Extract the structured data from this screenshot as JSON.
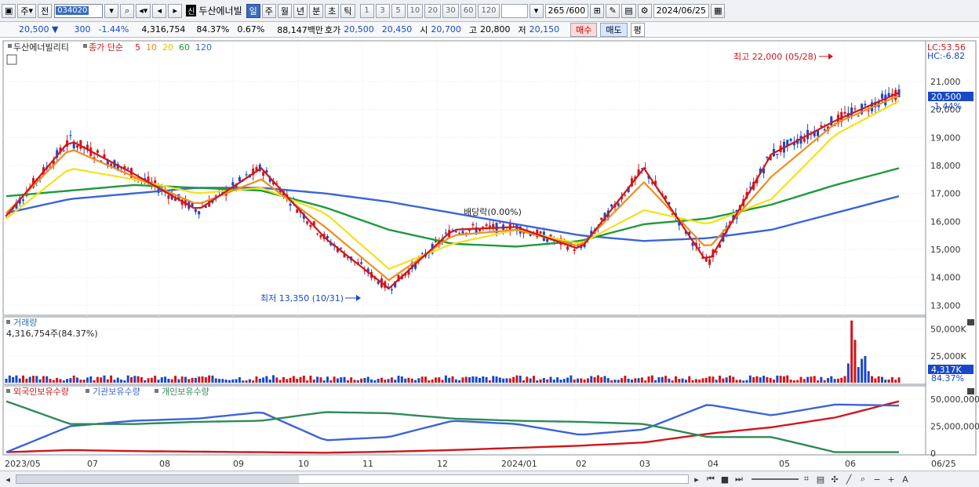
{
  "toolbar": {
    "market_select": "주",
    "prev_label": "전",
    "code": "034020",
    "stock_name": "두산에너빌",
    "credit_badge": "신",
    "periods": [
      "일",
      "주",
      "월",
      "년",
      "분",
      "초",
      "틱"
    ],
    "selected_period": "일",
    "intervals": [
      "1",
      "3",
      "5",
      "10",
      "20",
      "30",
      "60",
      "120"
    ],
    "count": "265",
    "count_max": "/600",
    "date": "2024/06/25"
  },
  "quote": {
    "price": "20,500",
    "direction": "▼",
    "change": "300",
    "change_pct": "-1.44%",
    "volume": "4,316,754",
    "vol_ratio": "84.37%",
    "turnover": "0.67%",
    "amount": "88,147백만",
    "bid_label": "호가",
    "ask": "20,500",
    "bid": "20,450",
    "open_label": "시",
    "open": "20,700",
    "high_label": "고",
    "high": "20,800",
    "low_label": "저",
    "low": "20,150",
    "buy_label": "매수",
    "sell_label": "매도",
    "avg_label": "평"
  },
  "price_panel": {
    "legend_name": "두산에너빌리티",
    "legend_ma": "종가 단순",
    "ma_periods": [
      "5",
      "10",
      "20",
      "60",
      "120"
    ],
    "lc": "LC:53.56",
    "hc": "HC:-6.82",
    "y_ticks": [
      "21,000",
      "20,000",
      "19,000",
      "18,000",
      "17,000",
      "16,000",
      "15,000",
      "14,000",
      "13,000"
    ],
    "last_price": "20,500",
    "last_pct": "-1.44%",
    "high_note": "최고 22,000 (05/28)",
    "low_note": "최저 13,350 (10/31)",
    "dividend_note": "배당락(0.00%)"
  },
  "volume_panel": {
    "title": "거래량",
    "value": "4,316,754주(84.37%)",
    "y_ticks": [
      "50,000K",
      "25,000K"
    ],
    "last_value": "4,317K",
    "last_pct": "84.37%"
  },
  "holdings_panel": {
    "legend": [
      "외국인보유수량",
      "기관보유수량",
      "개인보유수량"
    ],
    "y_ticks": [
      "50,000,000",
      "25,000,000",
      "0"
    ]
  },
  "x_axis": [
    "2023/05",
    "07",
    "08",
    "09",
    "10",
    "11",
    "12",
    "2024/01",
    "02",
    "03",
    "04",
    "05",
    "06",
    "06/25"
  ],
  "colors": {
    "ma5": "#d0161b",
    "ma10": "#f08c1e",
    "ma20": "#f2e21a",
    "ma60": "#1f9a3a",
    "ma120": "#3a64d8",
    "up": "#d0161b",
    "down": "#1848c8",
    "foreign": "#d0161b",
    "institution": "#3a64d8",
    "individual": "#2e8b57"
  },
  "chart_data": [
    {
      "type": "line",
      "name": "price_ma",
      "x": [
        "2023/05",
        "06",
        "07",
        "08",
        "09",
        "10",
        "11",
        "12",
        "2024/01",
        "02",
        "03",
        "04",
        "05",
        "06",
        "06/25"
      ],
      "series": [
        {
          "name": "5",
          "values": [
            16200,
            18900,
            17700,
            16400,
            17900,
            15400,
            13600,
            15700,
            15800,
            15000,
            17900,
            14500,
            18400,
            19600,
            20600
          ]
        },
        {
          "name": "10",
          "values": [
            16300,
            18600,
            17600,
            16600,
            17500,
            15800,
            13900,
            15500,
            15700,
            15100,
            17400,
            15000,
            17600,
            19500,
            20500
          ]
        },
        {
          "name": "20",
          "values": [
            16100,
            17900,
            17500,
            17000,
            17200,
            16300,
            14300,
            15200,
            15700,
            15200,
            16400,
            15900,
            16800,
            19100,
            20300
          ]
        },
        {
          "name": "60",
          "values": [
            16900,
            17100,
            17300,
            17200,
            17100,
            16500,
            15700,
            15200,
            15100,
            15300,
            15900,
            16100,
            16600,
            17300,
            17900
          ]
        },
        {
          "name": "120",
          "values": [
            16300,
            16800,
            17000,
            17200,
            17200,
            17000,
            16700,
            16300,
            15900,
            15500,
            15300,
            15400,
            15700,
            16300,
            16900
          ]
        }
      ],
      "ylim": [
        12700,
        22400
      ]
    },
    {
      "type": "bar",
      "name": "volume",
      "ylim": [
        0,
        60000
      ],
      "ylabel": "K"
    },
    {
      "type": "line",
      "name": "holdings",
      "series": [
        {
          "name": "외국인보유수량",
          "values": [
            1000,
            3000,
            2000,
            1500,
            1000,
            500,
            1500,
            3000,
            5000,
            7000,
            10000,
            18000,
            24000,
            33000,
            48000
          ]
        },
        {
          "name": "기관보유수량",
          "values": [
            1000,
            25000,
            30000,
            32000,
            38000,
            12000,
            15000,
            30000,
            27000,
            17000,
            22000,
            45000,
            35000,
            45000,
            44000
          ]
        },
        {
          "name": "개인보유수량",
          "values": [
            48000,
            27000,
            27000,
            29000,
            30000,
            38000,
            37000,
            32000,
            30000,
            29000,
            27000,
            15000,
            15000,
            1000,
            1000
          ]
        }
      ],
      "ylim": [
        0,
        55000
      ]
    }
  ]
}
